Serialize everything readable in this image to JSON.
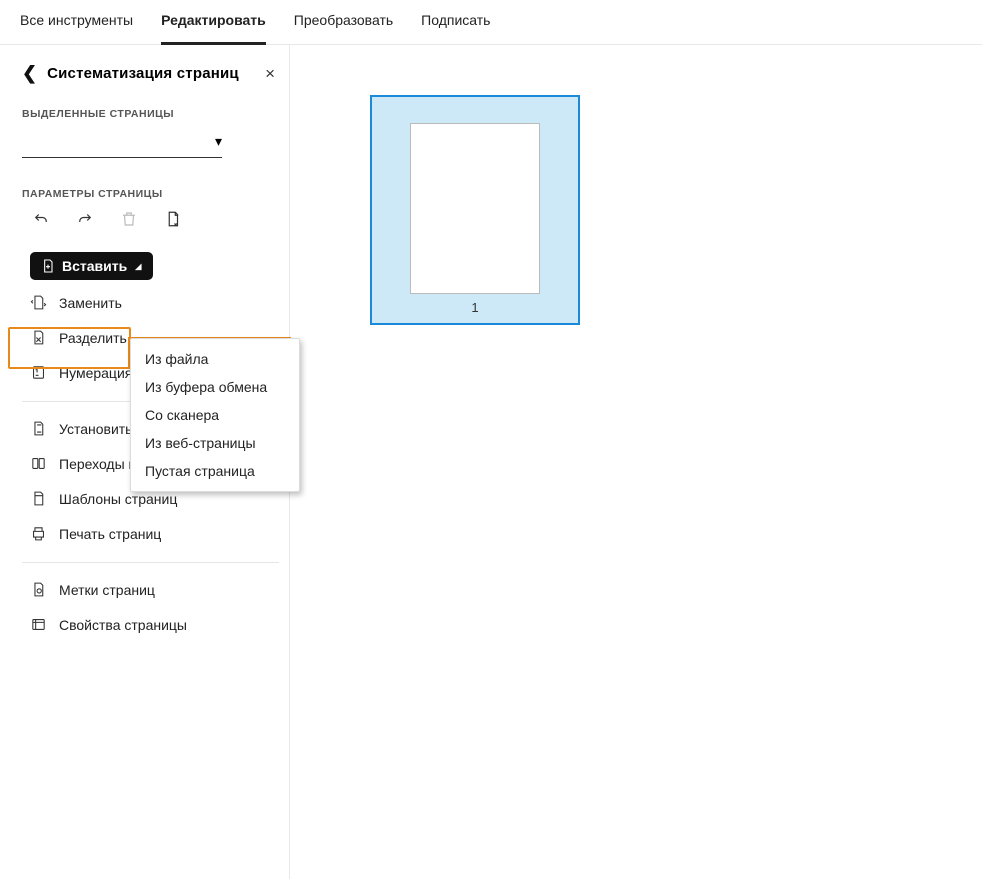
{
  "tabs": {
    "all_tools": "Все инструменты",
    "edit": "Редактировать",
    "convert": "Преобразовать",
    "sign": "Подписать",
    "active": "edit"
  },
  "panel": {
    "title": "Систематизация страниц",
    "close": "×",
    "back": "‹"
  },
  "sections": {
    "selected_pages": "ВЫДЕЛЕННЫЕ СТРАНИЦЫ",
    "page_params": "ПАРАМЕТРЫ СТРАНИЦЫ"
  },
  "selected_pages_value": "",
  "iconbar": {
    "undo": "undo-icon",
    "redo": "redo-icon",
    "delete": "trash-icon",
    "extract": "extract-page-icon"
  },
  "insert_button": {
    "label": "Вставить"
  },
  "dropdown": {
    "items": [
      "Из файла",
      "Из буфера обмена",
      "Со сканера",
      "Из веб-страницы",
      "Пустая страница"
    ]
  },
  "ops": {
    "replace": "Заменить",
    "split": "Разделить",
    "numbering": "Нумерация"
  },
  "ops2": {
    "set_margins": "Установить поля страницы",
    "transitions": "Переходы между страницами",
    "templates": "Шаблоны страниц",
    "print": "Печать страниц"
  },
  "ops3": {
    "labels": "Метки страниц",
    "properties": "Свойства страницы"
  },
  "thumbnail": {
    "page_number": "1"
  }
}
